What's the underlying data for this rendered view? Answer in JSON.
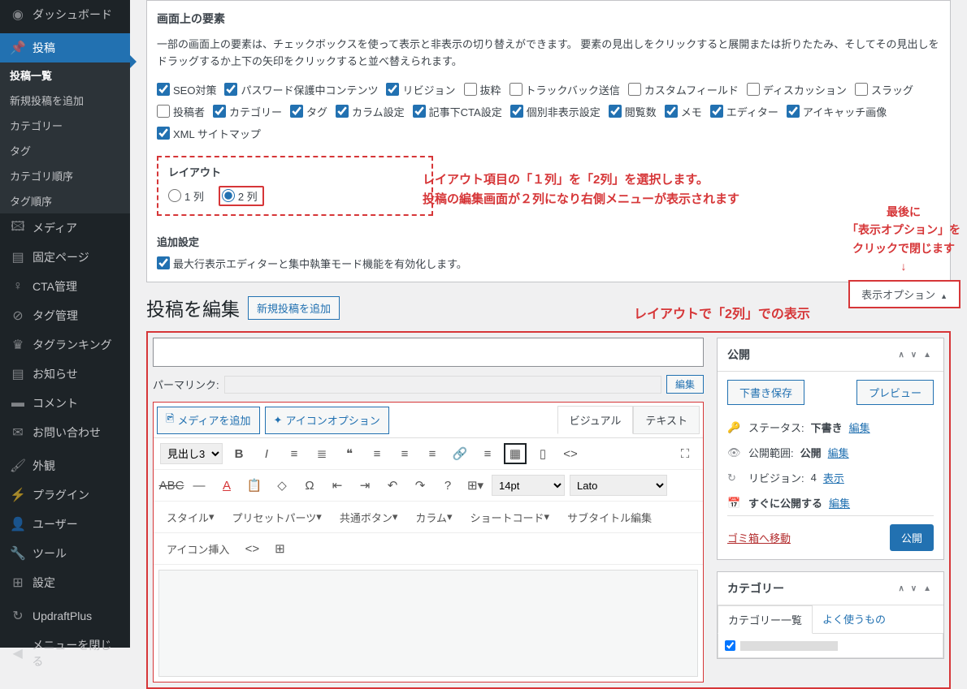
{
  "sidebar": {
    "items": [
      {
        "label": "ダッシュボード",
        "icon": "⚙"
      },
      {
        "label": "投稿",
        "icon": "📌",
        "active": true
      },
      {
        "label": "投稿一覧",
        "sub": true,
        "current": true
      },
      {
        "label": "新規投稿を追加",
        "sub": true
      },
      {
        "label": "カテゴリー",
        "sub": true
      },
      {
        "label": "タグ",
        "sub": true
      },
      {
        "label": "カテゴリ順序",
        "sub": true
      },
      {
        "label": "タグ順序",
        "sub": true
      },
      {
        "label": "メディア",
        "icon": "🖼"
      },
      {
        "label": "固定ページ",
        "icon": "📄"
      },
      {
        "label": "CTA管理",
        "icon": "💡"
      },
      {
        "label": "タグ管理",
        "icon": "🏷"
      },
      {
        "label": "タグランキング",
        "icon": "🏆"
      },
      {
        "label": "お知らせ",
        "icon": "📋"
      },
      {
        "label": "コメント",
        "icon": "💬"
      },
      {
        "label": "お問い合わせ",
        "icon": "✉"
      },
      {
        "label": "外観",
        "icon": "🖌"
      },
      {
        "label": "プラグイン",
        "icon": "🔌"
      },
      {
        "label": "ユーザー",
        "icon": "👤"
      },
      {
        "label": "ツール",
        "icon": "🔧"
      },
      {
        "label": "設定",
        "icon": "⚙"
      },
      {
        "label": "UpdraftPlus",
        "icon": "↻"
      },
      {
        "label": "メニューを閉じる",
        "icon": "◀"
      }
    ]
  },
  "screenElements": {
    "title": "画面上の要素",
    "description": "一部の画面上の要素は、チェックボックスを使って表示と非表示の切り替えができます。 要素の見出しをクリックすると展開または折りたたみ、そしてその見出しをドラッグするか上下の矢印をクリックすると並べ替えられます。",
    "checkboxes": [
      {
        "label": "SEO対策",
        "checked": true
      },
      {
        "label": "パスワード保護中コンテンツ",
        "checked": true
      },
      {
        "label": "リビジョン",
        "checked": true
      },
      {
        "label": "抜粋",
        "checked": false
      },
      {
        "label": "トラックバック送信",
        "checked": false
      },
      {
        "label": "カスタムフィールド",
        "checked": false
      },
      {
        "label": "ディスカッション",
        "checked": false
      },
      {
        "label": "スラッグ",
        "checked": false
      },
      {
        "label": "投稿者",
        "checked": false
      },
      {
        "label": "カテゴリー",
        "checked": true
      },
      {
        "label": "タグ",
        "checked": true
      },
      {
        "label": "カラム設定",
        "checked": true
      },
      {
        "label": "記事下CTA設定",
        "checked": true
      },
      {
        "label": "個別非表示設定",
        "checked": true
      },
      {
        "label": "閲覧数",
        "checked": true
      },
      {
        "label": "メモ",
        "checked": true
      },
      {
        "label": "エディター",
        "checked": true
      },
      {
        "label": "アイキャッチ画像",
        "checked": true
      },
      {
        "label": "XML サイトマップ",
        "checked": true
      }
    ]
  },
  "layout": {
    "title": "レイアウト",
    "options": [
      {
        "label": "1 列",
        "selected": false
      },
      {
        "label": "2 列",
        "selected": true
      }
    ]
  },
  "additional": {
    "title": "追加設定",
    "option": {
      "label": "最大行表示エディターと集中執筆モード機能を有効化します。",
      "checked": true
    }
  },
  "annotations": {
    "ann1_line1": "レイアウト項目の「１列」を「2列」を選択します。",
    "ann1_line2": "投稿の編集画面が２列になり右側メニューが表示されます",
    "ann2_line1": "最後に",
    "ann2_line2": "「表示オプション」を",
    "ann2_line3": "クリックで閉じます",
    "ann2_arrow": "↓",
    "ann3": "レイアウトで「2列」での表示"
  },
  "toggleBtn": "表示オプション",
  "editHeader": {
    "title": "投稿を編集",
    "newLink": "新規投稿を追加"
  },
  "permalink": {
    "label": "パーマリンク:",
    "editBtn": "編集"
  },
  "editor": {
    "mediaBtn": "メディアを追加",
    "iconBtn": "アイコンオプション",
    "tabs": [
      "ビジュアル",
      "テキスト"
    ],
    "formatSelect": "見出し3",
    "fontSize": "14pt",
    "fontFamily": "Lato",
    "row3": [
      "スタイル",
      "プリセットパーツ",
      "共通ボタン",
      "カラム",
      "ショートコード",
      "サブタイトル編集"
    ],
    "row4": "アイコン挿入"
  },
  "publish": {
    "title": "公開",
    "saveDraft": "下書き保存",
    "preview": "プレビュー",
    "statusLabel": "ステータス:",
    "statusValue": "下書き",
    "visibilityLabel": "公開範囲:",
    "visibilityValue": "公開",
    "revisionLabel": "リビジョン:",
    "revisionValue": "4",
    "revisionLink": "表示",
    "scheduleLabel": "すぐに公開する",
    "editLink": "編集",
    "trash": "ゴミ箱へ移動",
    "publishBtn": "公開"
  },
  "category": {
    "title": "カテゴリー",
    "tabs": [
      "カテゴリー一覧",
      "よく使うもの"
    ]
  }
}
